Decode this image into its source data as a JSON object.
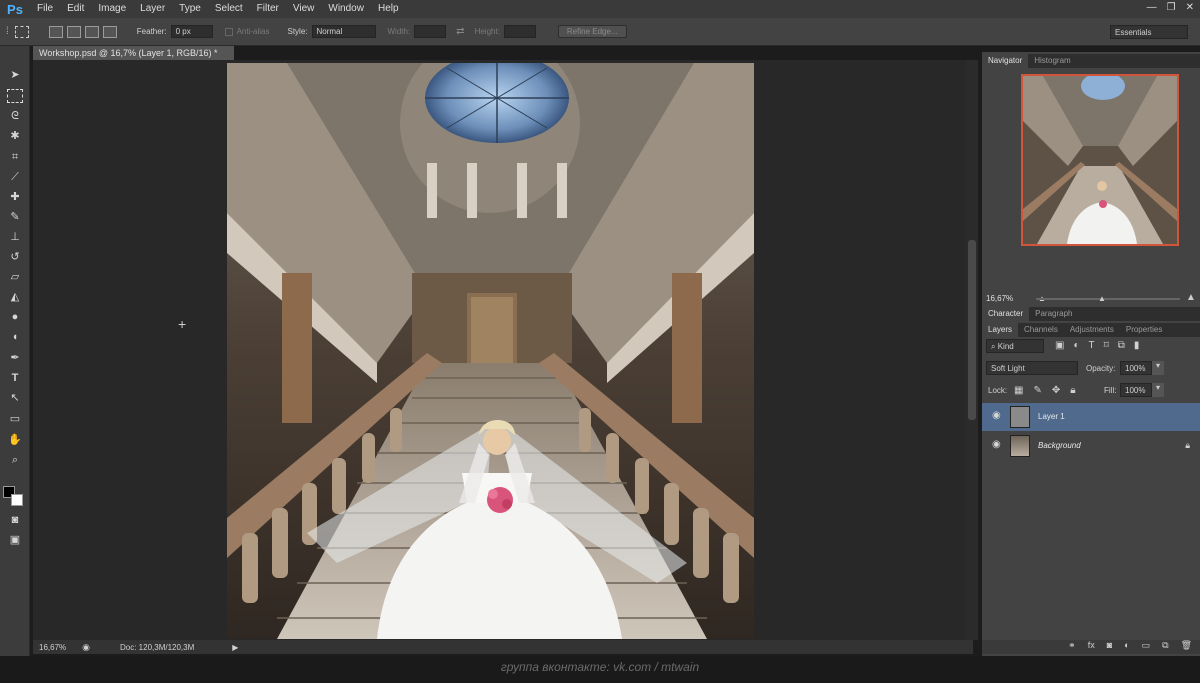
{
  "app": {
    "logo": "Ps"
  },
  "menu": [
    "File",
    "Edit",
    "Image",
    "Layer",
    "Type",
    "Select",
    "Filter",
    "View",
    "Window",
    "Help"
  ],
  "window_controls": [
    "—",
    "❐",
    "✕"
  ],
  "options": {
    "feather_label": "Feather:",
    "feather_value": "0 px",
    "anti_alias_label": "Anti-alias",
    "style_label": "Style:",
    "style_value": "Normal",
    "width_label": "Width:",
    "height_label": "Height:",
    "refine_edge": "Refine Edge...",
    "workspace": "Essentials"
  },
  "document": {
    "tab_title": "Workshop.psd @ 16,7% (Layer 1, RGB/16) *",
    "tab_close": "×",
    "zoom": "16,67%",
    "doc_info": "Doc: 120,3M/120,3M"
  },
  "navigator": {
    "tabs": [
      "Navigator",
      "Histogram"
    ],
    "zoom": "16,67%"
  },
  "char_panel": {
    "tabs": [
      "Character",
      "Paragraph"
    ]
  },
  "layers_panel": {
    "tabs": [
      "Layers",
      "Channels",
      "Adjustments",
      "Properties"
    ],
    "kind": "Kind",
    "blend_mode": "Soft Light",
    "opacity_label": "Opacity:",
    "opacity_value": "100%",
    "lock_label": "Lock:",
    "fill_label": "Fill:",
    "fill_value": "100%",
    "layers": [
      {
        "name": "Layer 1",
        "selected": true
      },
      {
        "name": "Background",
        "selected": false,
        "locked": true
      }
    ],
    "bottom_icons": [
      "link-icon",
      "fx-icon",
      "mask-icon",
      "adjustment-icon",
      "group-icon",
      "new-layer-icon",
      "trash-icon"
    ]
  },
  "footer": {
    "watermark": "группа вконтакте: vk.com / mtwain"
  },
  "colors": {
    "accent_blue": "#4fb3ff",
    "selected_layer": "#4f6a8c",
    "nav_frame": "#d0553a"
  }
}
